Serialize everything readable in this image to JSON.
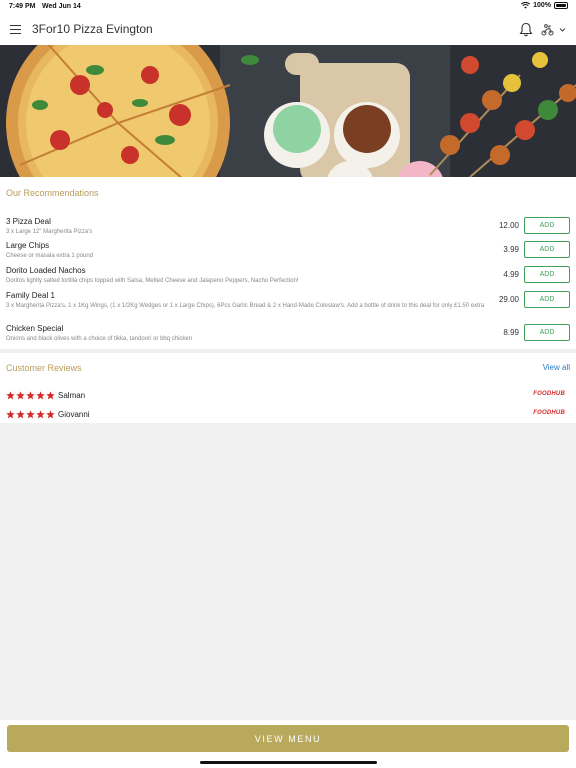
{
  "status_bar": {
    "time": "7:49 PM",
    "date": "Wed Jun 14",
    "battery": "100%"
  },
  "header": {
    "title": "3For10 Pizza Evington"
  },
  "recommendations": {
    "title": "Our Recommendations",
    "items": [
      {
        "name": "3 Pizza Deal",
        "description": "3 x Large 12\" Margherita Pizza's",
        "price": "12.00",
        "action": "ADD"
      },
      {
        "name": "Large Chips",
        "description": "Cheese or masala extra 1 pound",
        "price": "3.99",
        "action": "ADD"
      },
      {
        "name": "Dorito Loaded Nachos",
        "description": "Doritos lightly salted tortilla chips topped with Salsa, Melted Cheese and Jalapeno Peppers, Nacho Perfection!",
        "price": "4.99",
        "action": "ADD"
      },
      {
        "name": "Family Deal 1",
        "description": "3 x Margherita Pizza's, 1 x 1Kg Wings, (1 x 1/2Kg Wedges or 1 x Large Chips), 6Pcs Garlic Bread & 2 x Hand-Made Coleslaw's. Add a bottle of drink to this deal for only £1.50 extra",
        "price": "29.00",
        "action": "ADD"
      },
      {
        "name": "Chicken Special",
        "description": "Onions and black olives with a choice of tikka, tandoori or bbq chicken",
        "price": "8.99",
        "action": "ADD"
      }
    ]
  },
  "reviews": {
    "title": "Customer Reviews",
    "view_all": "View all",
    "items": [
      {
        "name": "Salman",
        "rating": 5,
        "source": "FOODHUB"
      },
      {
        "name": "Giovanni",
        "rating": 5,
        "source": "FOODHUB"
      }
    ]
  },
  "footer": {
    "button": "VIEW MENU"
  },
  "colors": {
    "accent": "#b9a95c",
    "add_green": "#3fa05a",
    "star_red": "#d42a2a",
    "link_blue": "#2a7bc4"
  }
}
